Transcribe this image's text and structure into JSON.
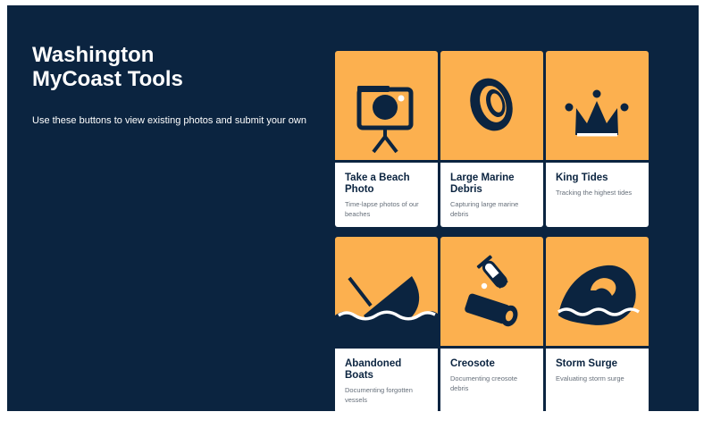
{
  "header": {
    "title_line1": "Washington",
    "title_line2": "MyCoast Tools",
    "subtitle": "Use these buttons to view existing photos and submit your own"
  },
  "tools": [
    {
      "name": "Take a Beach Photo",
      "description": "Time-lapse photos of our beaches",
      "icon": "camera-icon"
    },
    {
      "name": "Large Marine Debris",
      "description": "Capturing large marine debris",
      "icon": "tire-icon"
    },
    {
      "name": "King Tides",
      "description": "Tracking the highest tides",
      "icon": "crown-icon"
    },
    {
      "name": "Abandoned Boats",
      "description": "Documenting forgotten vessels",
      "icon": "sinking-boat-icon"
    },
    {
      "name": "Creosote",
      "description": "Documenting creosote debris",
      "icon": "creosote-log-icon"
    },
    {
      "name": "Storm Surge",
      "description": "Evaluating storm surge",
      "icon": "wave-icon"
    }
  ],
  "colors": {
    "background": "#0b2440",
    "card_art": "#fcb04f",
    "card_info": "#ffffff",
    "icon": "#0b2440"
  }
}
